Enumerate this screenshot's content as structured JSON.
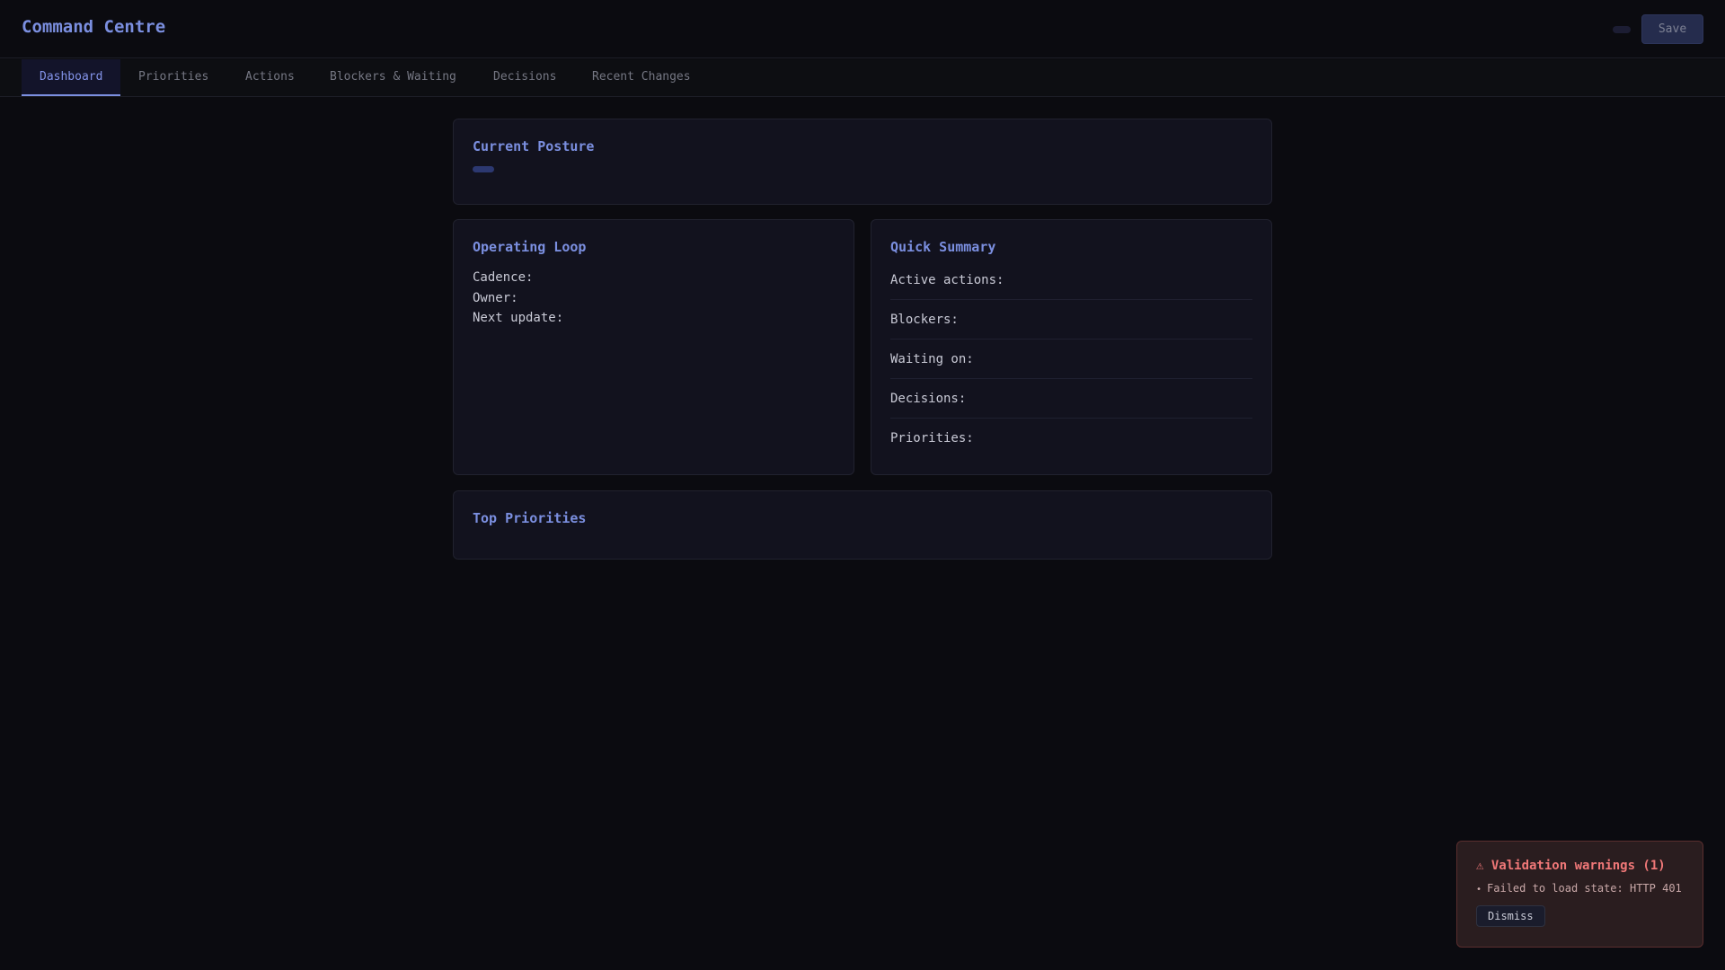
{
  "header": {
    "title": "Command Centre",
    "save_label": "Save"
  },
  "tabs": [
    {
      "label": "Dashboard"
    },
    {
      "label": "Priorities"
    },
    {
      "label": "Actions"
    },
    {
      "label": "Blockers & Waiting"
    },
    {
      "label": "Decisions"
    },
    {
      "label": "Recent Changes"
    }
  ],
  "posture": {
    "title": "Current Posture"
  },
  "loop": {
    "title": "Operating Loop",
    "cadence": "Cadence:",
    "owner": "Owner:",
    "next": "Next update:"
  },
  "summary": {
    "title": "Quick Summary",
    "rows": [
      "Active actions:",
      "Blockers:",
      "Waiting on:",
      "Decisions:",
      "Priorities:"
    ]
  },
  "top": {
    "title": "Top Priorities"
  },
  "toast": {
    "title": "⚠ Validation warnings (1)",
    "items": [
      "Failed to load state: HTTP 401"
    ],
    "dismiss": "Dismiss"
  }
}
